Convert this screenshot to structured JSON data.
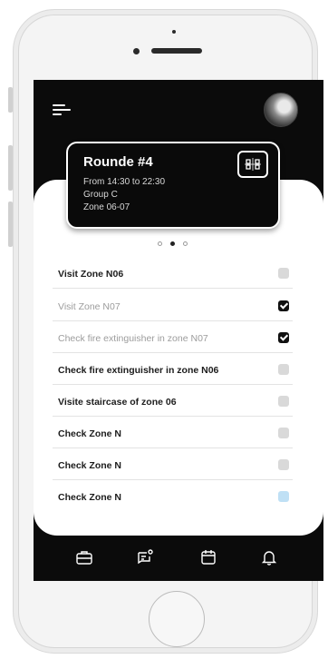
{
  "header": {
    "menu_icon": "hamburger-menu-icon",
    "avatar_icon": "user-avatar"
  },
  "round": {
    "title": "Rounde #4",
    "time": "From 14:30 to 22:30",
    "group": "Group C",
    "zone": "Zone 06-07",
    "scan_icon": "qr-scan-icon"
  },
  "pager": {
    "count": 3,
    "active_index": 1
  },
  "tasks": [
    {
      "label": "Visit Zone N06",
      "checked": false
    },
    {
      "label": "Visit Zone N07",
      "checked": true
    },
    {
      "label": "Check fire extinguisher in zone N07",
      "checked": true
    },
    {
      "label": "Check fire extinguisher in zone N06",
      "checked": false
    },
    {
      "label": "Visite staircase of zone 06",
      "checked": false
    },
    {
      "label": "Check Zone N",
      "checked": false
    },
    {
      "label": "Check Zone N",
      "checked": false
    },
    {
      "label": "Check Zone N",
      "checked": false
    }
  ],
  "nav": [
    {
      "name": "briefcase-icon"
    },
    {
      "name": "message-icon"
    },
    {
      "name": "calendar-icon"
    },
    {
      "name": "bell-icon"
    }
  ],
  "colors": {
    "screen_bg": "#0b0b0b",
    "card_bg": "#ffffff",
    "checkbox_idle": "#d9d9d9",
    "checkbox_focus": "#bfe0f5"
  }
}
